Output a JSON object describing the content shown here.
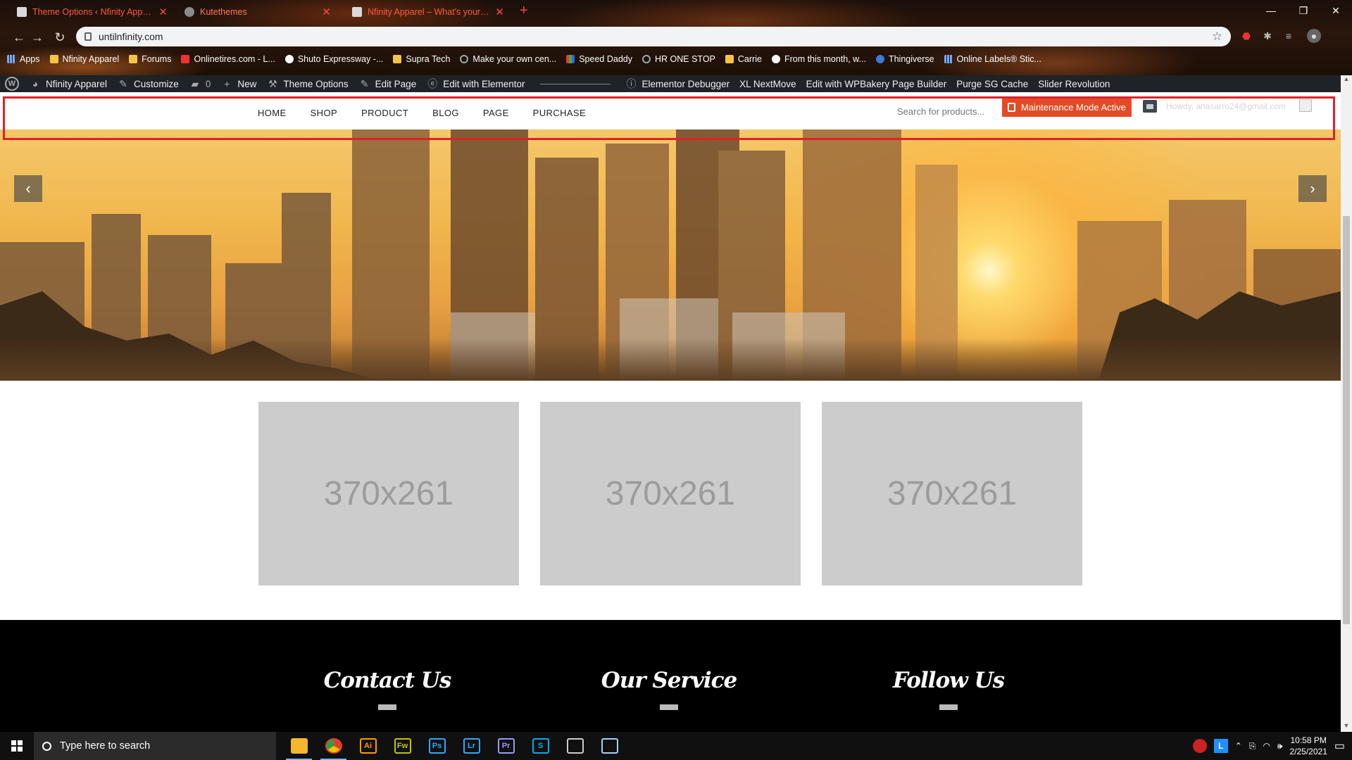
{
  "browser": {
    "tabs": [
      {
        "title": "Theme Options ‹ Nfinity Apparel"
      },
      {
        "title": "Kutethemes"
      },
      {
        "title": "Nfinity Apparel – What's your pa"
      }
    ],
    "url": "untilnfinity.com",
    "bookmarks": [
      "Apps",
      "Nfinity Apparel",
      "Forums",
      "Onlinetires.com - L...",
      "Shuto Expressway -...",
      "Supra Tech",
      "Make your own cen...",
      "Speed Daddy",
      "HR ONE STOP",
      "Carrie",
      "From this month, w...",
      "Thingiverse",
      "Online Labels® Stic..."
    ]
  },
  "wpbar": {
    "site": "Nfinity Apparel",
    "customize": "Customize",
    "comments": "0",
    "new": "New",
    "theme_options": "Theme Options",
    "edit_page": "Edit Page",
    "edit_elementor": "Edit with Elementor",
    "debugger": "Elementor Debugger",
    "nextmove": "XL NextMove",
    "wpbakery": "Edit with WPBakery Page Builder",
    "purge": "Purge SG Cache",
    "slider": "Slider Revolution"
  },
  "header": {
    "menu": [
      "HOME",
      "SHOP",
      "PRODUCT",
      "BLOG",
      "PAGE",
      "PURCHASE"
    ],
    "search_placeholder": "Search for products...",
    "maintenance": "Maintenance Mode Active",
    "howdy": "Howdy, anasarro24@gmail.com"
  },
  "hero": {
    "prev": "‹",
    "next": "›"
  },
  "thumbnails": [
    "370x261",
    "370x261",
    "370x261"
  ],
  "footer": {
    "columns": [
      "Contact Us",
      "Our Service",
      "Follow Us"
    ]
  },
  "taskbar": {
    "search": "Type here to search",
    "time": "10:58 PM",
    "date": "2/25/2021",
    "apps": [
      {
        "icon": "file-explorer-icon",
        "label": "",
        "color": "#f3b82b"
      },
      {
        "icon": "chrome-icon",
        "label": "",
        "color": "#e0402a"
      },
      {
        "icon": "illustrator-icon",
        "label": "Ai",
        "color": "#ff9a00"
      },
      {
        "icon": "fireworks-icon",
        "label": "Fw",
        "color": "#c4c400"
      },
      {
        "icon": "photoshop-icon",
        "label": "Ps",
        "color": "#31a8ff"
      },
      {
        "icon": "lightroom-icon",
        "label": "Lr",
        "color": "#31a8ff"
      },
      {
        "icon": "premiere-icon",
        "label": "Pr",
        "color": "#9999ff"
      },
      {
        "icon": "skype-icon",
        "label": "S",
        "color": "#00aff0"
      },
      {
        "icon": "store-icon",
        "label": "",
        "color": "#cccccc"
      },
      {
        "icon": "notes-icon",
        "label": "",
        "color": "#9fd3ff"
      }
    ]
  },
  "colors": {
    "accent": "#e24b26",
    "highlight_frame": "#e0202a",
    "wp_bar": "#1d2327"
  }
}
